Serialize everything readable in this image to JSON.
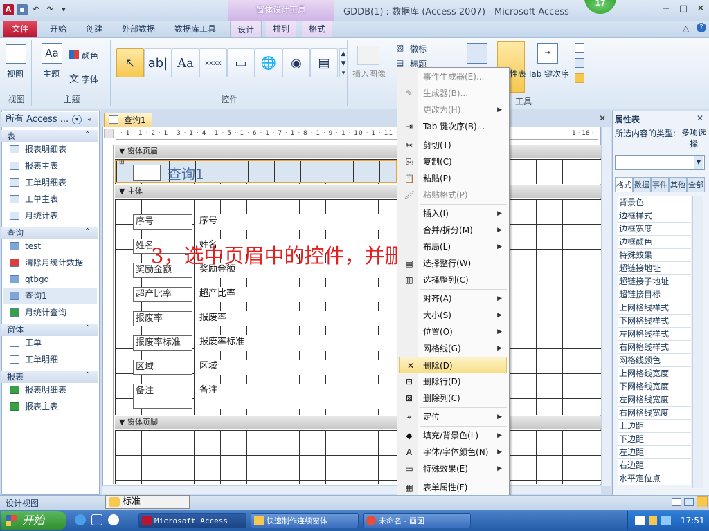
{
  "window": {
    "title": "GDDB(1) : 数据库 (Access 2007)  -  Microsoft Access",
    "context_tools": "窗体设计工具",
    "badge": "17",
    "minimize": "−",
    "maximize": "□",
    "close": "✕"
  },
  "tabs": [
    "文件",
    "开始",
    "创建",
    "外部数据",
    "数据库工具",
    "设计",
    "排列",
    "格式"
  ],
  "ribbon": {
    "view_label": "视图",
    "view_group": "视图",
    "theme_label": "主题",
    "color_label": "颜色",
    "font_label": "字体",
    "theme_group": "主题",
    "controls_group": "控件",
    "insert_image": "插入图像",
    "logo": "徽标",
    "title": "标题",
    "tab_order": "Tab 键次序",
    "sheet_suffix": "性表",
    "tools_group": "工具"
  },
  "nav": {
    "header": "所有 Access ...",
    "sections": [
      {
        "name": "表",
        "items": [
          "报表明细表",
          "报表主表",
          "工单明细表",
          "工单主表",
          "月统计表"
        ]
      },
      {
        "name": "查询",
        "items": [
          "test",
          "清除月统计数据",
          "qtbgd",
          "查询1",
          "月统计查询"
        ]
      },
      {
        "name": "窗体",
        "items": [
          "工单",
          "工单明细"
        ]
      },
      {
        "name": "报表",
        "items": [
          "报表明细表",
          "报表主表"
        ]
      }
    ]
  },
  "document": {
    "tab": "查询1",
    "ruler": "· 1 · 1 · 2 · 1 · 3 · 1 · 4 · 1 · 5 · 1 · 6 · 1 · 7 · 1 · 8 · 1 · 9 · 1 · 10 · 1 · 11 ·",
    "ruler_tail": "1 · 18 ·",
    "header_section": "窗体页眉",
    "detail_section": "主体",
    "footer_section": "窗体页脚",
    "form_title": "查询1",
    "fields": [
      {
        "label": "序号",
        "value": "序号"
      },
      {
        "label": "姓名",
        "value": "姓名"
      },
      {
        "label": "奖励金额",
        "value": "奖励金额"
      },
      {
        "label": "超产比率",
        "value": "超产比率"
      },
      {
        "label": "报废率",
        "value": "报废率"
      },
      {
        "label": "报废率标准",
        "value": "报废率标准"
      },
      {
        "label": "区域",
        "value": "区域"
      },
      {
        "label": "备注",
        "value": "备注"
      }
    ],
    "overlay": "3，选中页眉中的控件，并删除。"
  },
  "context_menu": [
    {
      "label": "事件生成器(E)...",
      "disabled": true,
      "icon": ""
    },
    {
      "label": "生成器(B)...",
      "disabled": true,
      "icon": "✎"
    },
    {
      "label": "更改为(H)",
      "disabled": true,
      "arrow": true,
      "icon": ""
    },
    {
      "label": "Tab 键次序(B)...",
      "icon": "⇥"
    },
    {
      "sep": true
    },
    {
      "label": "剪切(T)",
      "icon": "✂"
    },
    {
      "label": "复制(C)",
      "icon": "⎘"
    },
    {
      "label": "粘贴(P)",
      "icon": "📋"
    },
    {
      "label": "粘贴格式(P)",
      "disabled": true,
      "icon": "🖌"
    },
    {
      "sep": true
    },
    {
      "label": "插入(I)",
      "arrow": true,
      "icon": ""
    },
    {
      "label": "合并/拆分(M)",
      "arrow": true,
      "icon": ""
    },
    {
      "label": "布局(L)",
      "arrow": true,
      "icon": ""
    },
    {
      "label": "选择整行(W)",
      "icon": "▤"
    },
    {
      "label": "选择整列(C)",
      "icon": "▥"
    },
    {
      "sep": true
    },
    {
      "label": "对齐(A)",
      "arrow": true,
      "icon": ""
    },
    {
      "label": "大小(S)",
      "arrow": true,
      "icon": ""
    },
    {
      "label": "位置(O)",
      "arrow": true,
      "icon": ""
    },
    {
      "label": "网格线(G)",
      "arrow": true,
      "icon": ""
    },
    {
      "label": "删除(D)",
      "highlight": true,
      "icon": "✕"
    },
    {
      "label": "删除行(D)",
      "icon": "⊟"
    },
    {
      "label": "删除列(C)",
      "icon": "⊠"
    },
    {
      "sep": true
    },
    {
      "label": "定位",
      "arrow": true,
      "icon": "⌖"
    },
    {
      "sep": true
    },
    {
      "label": "填充/背景色(L)",
      "arrow": true,
      "icon": "◆"
    },
    {
      "label": "字体/字体颜色(N)",
      "arrow": true,
      "icon": "A"
    },
    {
      "label": "特殊效果(E)",
      "arrow": true,
      "icon": "▭"
    },
    {
      "sep": true
    },
    {
      "label": "表单属性(F)",
      "icon": "▦"
    },
    {
      "label": "属性(P)",
      "icon": "▣"
    }
  ],
  "property_sheet": {
    "title": "属性表",
    "close": "✕",
    "type_label": "所选内容的类型:",
    "type_value": "多项选择",
    "tabs": [
      "格式",
      "数据",
      "事件",
      "其他",
      "全部"
    ],
    "rows": [
      "背景色",
      "边框样式",
      "边框宽度",
      "边框颜色",
      "特殊效果",
      "超链接地址",
      "超链接子地址",
      "超链接目标",
      "上网格线样式",
      "下网格线样式",
      "左网格线样式",
      "右网格线样式",
      "网格线颜色",
      "上网格线宽度",
      "下网格线宽度",
      "左网格线宽度",
      "右网格线宽度",
      "上边距",
      "下边距",
      "左边距",
      "右边距",
      "水平定位点"
    ]
  },
  "status": {
    "text": "设计视图",
    "ime": "标准"
  },
  "taskbar": {
    "start": "开始",
    "tasks": [
      "Microsoft Access ...",
      "快速制作连续窗体",
      "未命名 - 画图"
    ],
    "clock": "17:51"
  },
  "colors": {
    "file_tab": "#c8233a",
    "accent": "#1e395b",
    "overlay_text": "#e32020",
    "menu_highlight": "#f7df88"
  }
}
